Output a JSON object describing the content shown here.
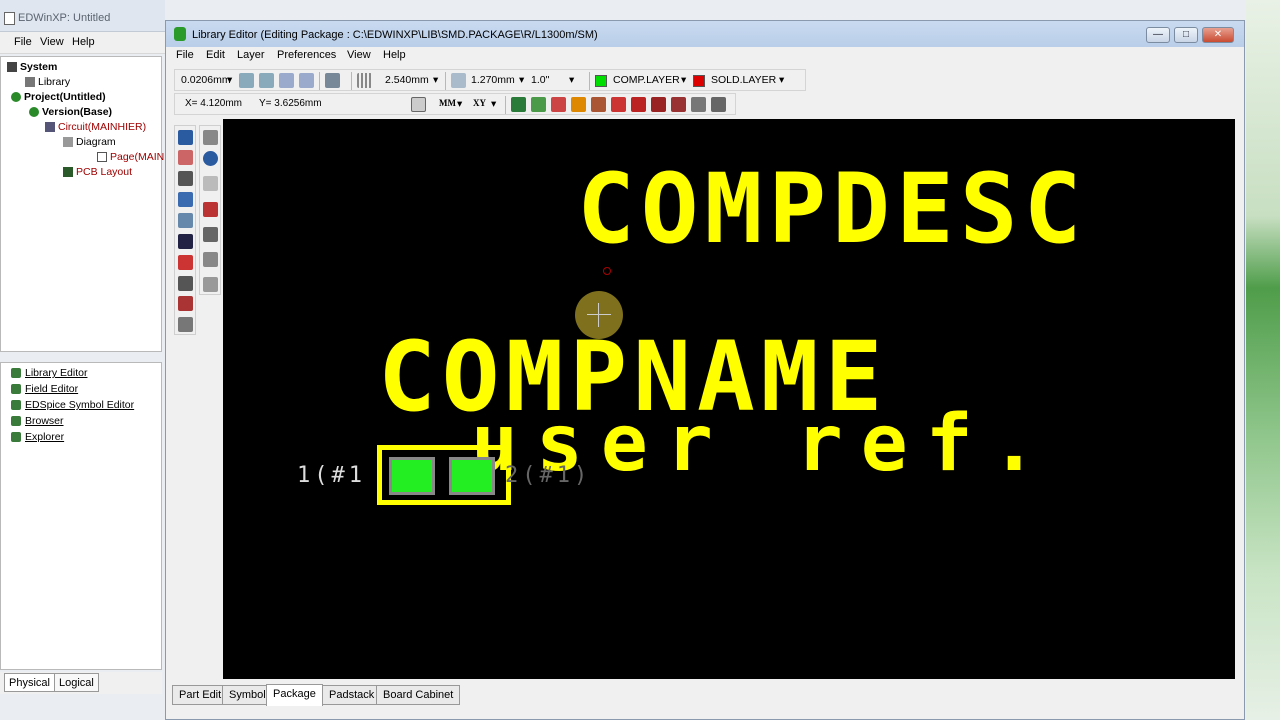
{
  "outer": {
    "title": "EDWinXP: Untitled",
    "menu": [
      "File",
      "View",
      "Help"
    ]
  },
  "tree": [
    {
      "label": "System",
      "bold": true
    },
    {
      "label": "Library",
      "bold": false
    },
    {
      "label": "Project(Untitled)",
      "bold": true
    },
    {
      "label": "Version(Base)",
      "bold": true
    },
    {
      "label": "Circuit(MAINHIER)",
      "bold": false
    },
    {
      "label": "Diagram",
      "bold": false
    },
    {
      "label": "Page(MAIN",
      "bold": false
    },
    {
      "label": "PCB Layout",
      "bold": false
    }
  ],
  "tools": [
    "Library Editor",
    "Field Editor",
    "EDSpice Symbol Editor",
    "Browser",
    "Explorer"
  ],
  "left_tabs": [
    "Physical",
    "Logical"
  ],
  "inner": {
    "title": "Library Editor (Editing Package : C:\\EDWINXP\\LIB\\SMD.PACKAGE\\R/L1300m/SM)",
    "menu": [
      "File",
      "Edit",
      "Layer",
      "Preferences",
      "View",
      "Help"
    ],
    "win_buttons": [
      "—",
      "□",
      "✕"
    ]
  },
  "toolbar": {
    "zoom_step": "0.0206mm",
    "grid": "2.540mm",
    "snap": "1.270mm",
    "width": "1.0\"",
    "layer1": "COMP.LAYER",
    "layer2": "SOLD.LAYER",
    "x": "X= 4.120mm",
    "y": "Y= 3.6256mm",
    "units": "MM",
    "coord_mode": "XY"
  },
  "colors": {
    "comp_layer": "#00dd00",
    "sold_layer": "#dd0000",
    "silk": "#ffff00",
    "pad": "#22ee22"
  },
  "canvas": {
    "compdesc": "COMPDESC",
    "compname": "COMPNAME",
    "userref": "user ref.",
    "pin1": "1(#1",
    "pin2": "2(#1)"
  },
  "bottom_tabs": [
    "Part Edit",
    "Symbol",
    "Package",
    "Padstack",
    "Board Cabinet"
  ],
  "active_tab": "Package"
}
